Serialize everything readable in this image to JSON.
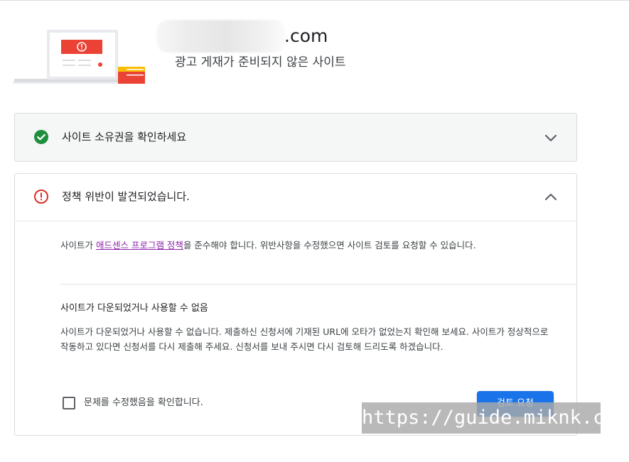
{
  "header": {
    "site_suffix": ".com",
    "site_status": "광고 게재가 준비되지 않은 사이트"
  },
  "colors": {
    "success_green": "#1e8e3e",
    "error_red": "#d93025",
    "link_purple": "#8e24aa",
    "button_blue": "#1a73e8",
    "card_gray": "#f5f6f6"
  },
  "ownership_card": {
    "icon": "check-circle-icon",
    "title": "사이트 소유권을 확인하세요",
    "expanded": false,
    "toggle_icon": "chevron-down-icon"
  },
  "policy_card": {
    "icon": "error-circle-icon",
    "title": "정책 위반이 발견되었습니다.",
    "expanded": true,
    "toggle_icon": "chevron-up-icon",
    "notice_prefix": "사이트가 ",
    "notice_link": "애드센스 프로그램 정책",
    "notice_suffix": "을 준수해야 합니다. 위반사항을 수정했으면 사이트 검토를 요청할 수 있습니다.",
    "issue_title": "사이트가 다운되었거나 사용할 수 없음",
    "issue_description": "사이트가 다운되었거나 사용할 수 없습니다. 제출하신 신청서에 기재된 URL에 오타가 없었는지 확인해 보세요. 사이트가 정상적으로 작동하고 있다면 신청서를 다시 제출해 주세요. 신청서를 보내 주시면 다시 검토해 드리도록 하겠습니다.",
    "checkbox_label": "문제를 수정했음을 확인합니다.",
    "checkbox_checked": false,
    "review_button_label": "검토 요청"
  },
  "watermark": "https://guide.miknk.co.kr"
}
